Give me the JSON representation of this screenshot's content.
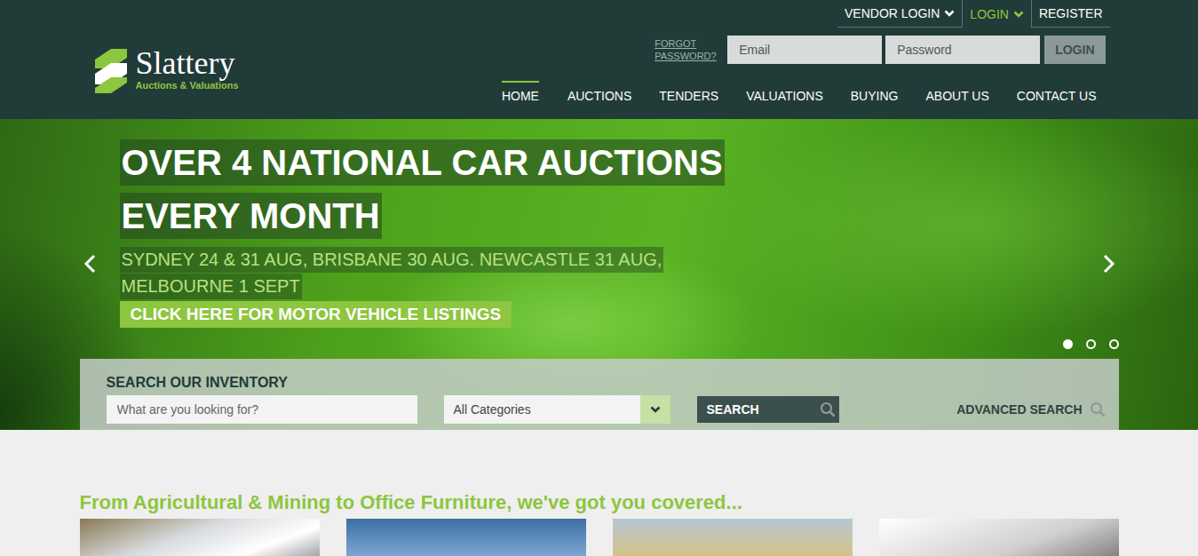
{
  "logo": {
    "name": "Slattery",
    "tagline": "Auctions & Valuations"
  },
  "top_links": [
    {
      "label": "VENDOR LOGIN",
      "selected": false
    },
    {
      "label": "LOGIN",
      "selected": true
    },
    {
      "label": "REGISTER",
      "selected": false
    }
  ],
  "login_form": {
    "forgot": "FORGOT PASSWORD?",
    "email_placeholder": "Email",
    "password_placeholder": "Password",
    "button": "LOGIN"
  },
  "nav": [
    {
      "label": "HOME",
      "selected": true
    },
    {
      "label": "AUCTIONS",
      "selected": false
    },
    {
      "label": "TENDERS",
      "selected": false
    },
    {
      "label": "VALUATIONS",
      "selected": false
    },
    {
      "label": "BUYING",
      "selected": false
    },
    {
      "label": "ABOUT US",
      "selected": false
    },
    {
      "label": "CONTACT US",
      "selected": false
    }
  ],
  "hero": {
    "title_lines": [
      "OVER 4 NATIONAL CAR AUCTIONS",
      "EVERY MONTH"
    ],
    "subtitle_lines": [
      "SYDNEY 24 & 31 AUG, BRISBANE 30 AUG. NEWCASTLE 31 AUG,",
      "MELBOURNE 1 SEPT"
    ],
    "cta": "CLICK HERE FOR MOTOR VEHICLE LISTINGS",
    "slides": [
      {
        "selected": true
      },
      {
        "selected": false
      },
      {
        "selected": false
      }
    ]
  },
  "search": {
    "title": "SEARCH OUR INVENTORY",
    "placeholder": "What are you looking for?",
    "category": "All Categories",
    "button": "SEARCH",
    "advanced": "ADVANCED SEARCH"
  },
  "categories": {
    "heading": "From Agricultural & Mining to Office Furniture, we've got you covered..."
  }
}
